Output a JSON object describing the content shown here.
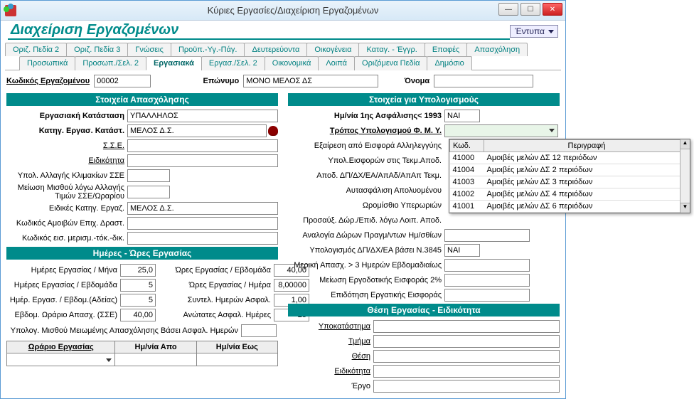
{
  "window": {
    "title": "Κύριες Εργασίες/Διαχείριση Εργαζομένων",
    "min": "—",
    "max": "☐",
    "close": "✕"
  },
  "subheader": {
    "title": "Διαχείριση Εργαζομένων",
    "print_btn": "Έντυπα"
  },
  "tabs_row1": [
    "Οριζ. Πεδία 2",
    "Οριζ. Πεδία 3",
    "Γνώσεις",
    "Προϋπ.-Υγ.-Πάγ.",
    "Δευτερεύοντα",
    "Οικογένεια",
    "Καταγ. - Έγγρ.",
    "Επαφές",
    "Απασχόληση"
  ],
  "tabs_row2": [
    "Προσωπικά",
    "Προσωπ./Σελ. 2",
    "Εργασιακά",
    "Εργασ./Σελ. 2",
    "Οικονομικά",
    "Λοιπά",
    "Οριζόμενα Πεδία",
    "Δημόσιο"
  ],
  "tabs_row2_selected": 2,
  "toprow": {
    "code_lbl": "Κωδικός Εργαζομένου",
    "code_val": "00002",
    "surname_lbl": "Επώνυμο",
    "surname_val": "ΜΟΝΟ ΜΕΛΟΣ ΔΣ",
    "name_lbl": "Όνομα",
    "name_val": ""
  },
  "left": {
    "section1": "Στοιχεία Απασχόλησης",
    "r1_lbl": "Εργασιακή Κατάσταση",
    "r1_val": "ΥΠΑΛΛΗΛΟΣ",
    "r2_lbl": "Κατηγ. Εργασ. Κατάστ.",
    "r2_val": "ΜΕΛΟΣ Δ.Σ.",
    "r3_lbl": "Σ.Σ.Ε.",
    "r3_val": "",
    "r4_lbl": "Ειδικότητα",
    "r4_val": "",
    "r5_lbl": "Υπολ. Αλλαγής Κλιμακίων ΣΣΕ",
    "r5_val": "",
    "r6_lbl": "Μείωση Μισθού λόγω Αλλαγής Τιμών ΣΣΕ/Ωραρίου",
    "r6_val": "",
    "r7_lbl": "Ειδικές Κατηγ. Εργαζ.",
    "r7_val": "ΜΕΛΟΣ Δ.Σ.",
    "r8_lbl": "Κωδικός Αμοιβών Επιχ. Δραστ.",
    "r8_val": "",
    "r9_lbl": "Κωδικός εισ. μερισμ.-τόκ.-δικ.",
    "r9_val": "",
    "section2": "Ημέρες - Ώρες Εργασίας",
    "g_l1_lbl": "Ημέρες Εργασίας / Μήνα",
    "g_l1_val": "25,0",
    "g_l2_lbl": "Ημέρες Εργασίας / Εβδομάδα",
    "g_l2_val": "5",
    "g_l3_lbl": "Ημέρ. Εργασ. / Εβδομ.(Αδείας)",
    "g_l3_val": "5",
    "g_l4_lbl": "Εβδομ. Ωράριο Απασχ. (ΣΣΕ)",
    "g_l4_val": "40,00",
    "g_r1_lbl": "Ώρες Εργασίας / Εβδομάδα",
    "g_r1_val": "40,00",
    "g_r2_lbl": "Ώρες Εργασίας / Ημέρα",
    "g_r2_val": "8,00000",
    "g_r3_lbl": "Συντελ. Ημερών Ασφαλ.",
    "g_r3_val": "1,00",
    "g_r4_lbl": "Ανώτατες Ασφαλ. Ημέρες",
    "g_r4_val": "25",
    "g_full_lbl": "Υπολογ. Μισθού Μειωμένης Απασχόλησης Βάσει Ασφαλ. Ημερών",
    "g_full_val": "",
    "sched_h1": "Ωράριο Εργασίας",
    "sched_h2": "Ημ/νία Απο",
    "sched_h3": "Ημ/νία Εως"
  },
  "right": {
    "section1": "Στοιχεία για Υπολογισμούς",
    "r1_lbl": "Ημ/νία 1ης Ασφάλισης< 1993",
    "r1_val": "ΝΑΙ",
    "r2_lbl": "Τρόπος Υπολογισμού Φ. Μ. Υ.",
    "r3_lbl": "Εξαίρεση από Εισφορά Αλληλεγγύης",
    "r4_lbl": "Υπολ.Εισφορών στις Τεκμ.Αποδ.",
    "r5_lbl": "Αποδ. ΔΠ/ΔΧ/ΕΑ/ΑπΑδ/ΑπΑπ Τεκμ.",
    "r6_lbl": "Αυτασφάλιση Απολυομένου",
    "r7_lbl": "Ωρομίσθιο Υπερωριών",
    "r8_lbl": "Προσαύξ. Δώρ./Επιδ. λόγω Λοιπ. Αποδ.",
    "r9_lbl": "Αναλογία Δώρων Πραγμ/ντων Ημ/σθίων",
    "r10_lbl": "Υπολογισμός ΔΠ/ΔΧ/ΕΑ βάσει Ν.3845",
    "r10_val": "ΝΑΙ",
    "r11_lbl": "Μερική Απασχ. > 3 Ημερών Εβδομαδιαίως",
    "r12_lbl": "Μείωση Εργοδοτικής Εισφοράς 2%",
    "r13_lbl": "Επιδότηση Εργατικής Εισφοράς",
    "section2": "Θέση Εργασίας - Ειδικότητα",
    "p1_lbl": "Υποκατάστημα",
    "p2_lbl": "Τμήμα",
    "p3_lbl": "Θέση",
    "p4_lbl": "Ειδικότητα",
    "p5_lbl": "Έργο"
  },
  "popup": {
    "h_code": "Κωδ.",
    "h_desc": "Περιγραφή",
    "rows": [
      {
        "code": "41000",
        "desc": "Αμοιβές μελών ΔΣ 12 περιόδων"
      },
      {
        "code": "41004",
        "desc": "Αμοιβές μελών ΔΣ 2 περιόδων"
      },
      {
        "code": "41003",
        "desc": "Αμοιβές μελών ΔΣ 3 περιόδων"
      },
      {
        "code": "41002",
        "desc": "Αμοιβές μελών ΔΣ 4 περιόδων"
      },
      {
        "code": "41001",
        "desc": "Αμοιβές μελών ΔΣ 6 περιόδων"
      }
    ]
  }
}
